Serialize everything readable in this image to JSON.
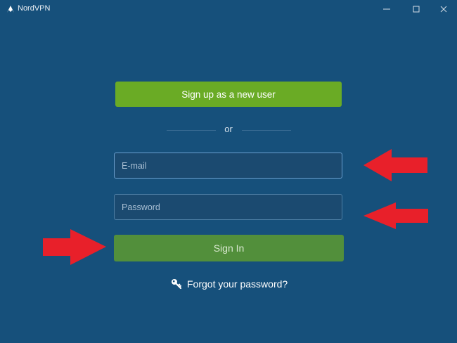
{
  "window": {
    "title": "NordVPN",
    "icons": {
      "logo": "nordvpn-logo-icon",
      "minimize": "minimize-icon",
      "maximize": "maximize-icon",
      "close": "close-icon"
    }
  },
  "login": {
    "signup_label": "Sign up as a new user",
    "or_label": "or",
    "email_placeholder": "E-mail",
    "password_placeholder": "Password",
    "signin_label": "Sign In",
    "forgot_label": "Forgot your password?",
    "forgot_icon": "key-icon"
  },
  "colors": {
    "background": "#16507b",
    "signup_button": "#6aab25",
    "signin_button": "#528f3b",
    "annotation_arrow": "#e8202a"
  }
}
